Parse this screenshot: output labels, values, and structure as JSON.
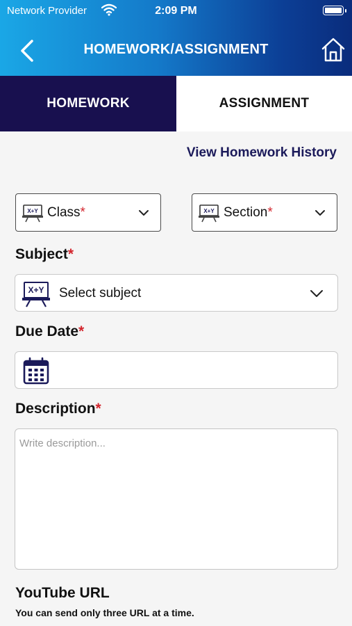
{
  "status_bar": {
    "carrier": "Network Provider",
    "time": "2:09 PM"
  },
  "header": {
    "title": "HOMEWORK/ASSIGNMENT"
  },
  "tabs": [
    {
      "label": "HOMEWORK",
      "active": true
    },
    {
      "label": "ASSIGNMENT",
      "active": false
    }
  ],
  "history_link": "View Homework History",
  "class_select": {
    "label": "Class",
    "required": "*"
  },
  "section_select": {
    "label": "Section",
    "required": "*"
  },
  "subject": {
    "label": "Subject",
    "required": "*",
    "placeholder": "Select subject",
    "icon_text": "X+Y"
  },
  "due_date": {
    "label": "Due Date",
    "required": "*"
  },
  "description": {
    "label": "Description",
    "required": "*",
    "placeholder": "Write description..."
  },
  "youtube": {
    "label": "YouTube URL",
    "note": "You can send only three URL at a time."
  },
  "colors": {
    "tab_active": "#18104f",
    "link": "#1b1a5a",
    "required": "#d3262e"
  }
}
